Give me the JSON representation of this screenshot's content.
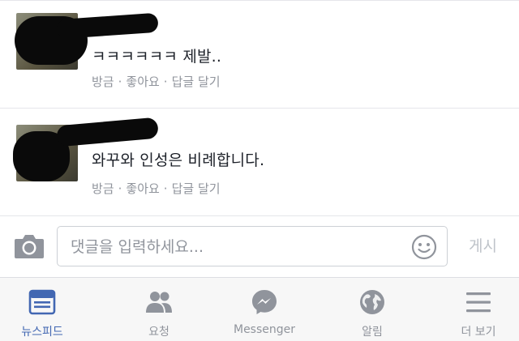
{
  "comments": [
    {
      "text": "ㅋㅋㅋㅋㅋㅋ 제발..",
      "time": "방금",
      "like": "좋아요",
      "reply": "답글 달기"
    },
    {
      "text": "와꾸와 인성은 비례합니다.",
      "time": "방금",
      "like": "좋아요",
      "reply": "답글 달기"
    }
  ],
  "composer": {
    "placeholder": "댓글을 입력하세요...",
    "post_label": "게시",
    "icons": [
      "camera-icon",
      "smiley-icon"
    ]
  },
  "tabs": [
    {
      "label": "뉴스피드",
      "icon": "news-feed-icon",
      "active": true
    },
    {
      "label": "요청",
      "icon": "friend-requests-icon",
      "active": false
    },
    {
      "label": "Messenger",
      "icon": "messenger-icon",
      "active": false
    },
    {
      "label": "알림",
      "icon": "notifications-globe-icon",
      "active": false
    },
    {
      "label": "더 보기",
      "icon": "menu-icon",
      "active": false
    }
  ],
  "colors": {
    "active_tab": "#4267b2",
    "inactive": "#90949c",
    "text": "#1d2129"
  }
}
